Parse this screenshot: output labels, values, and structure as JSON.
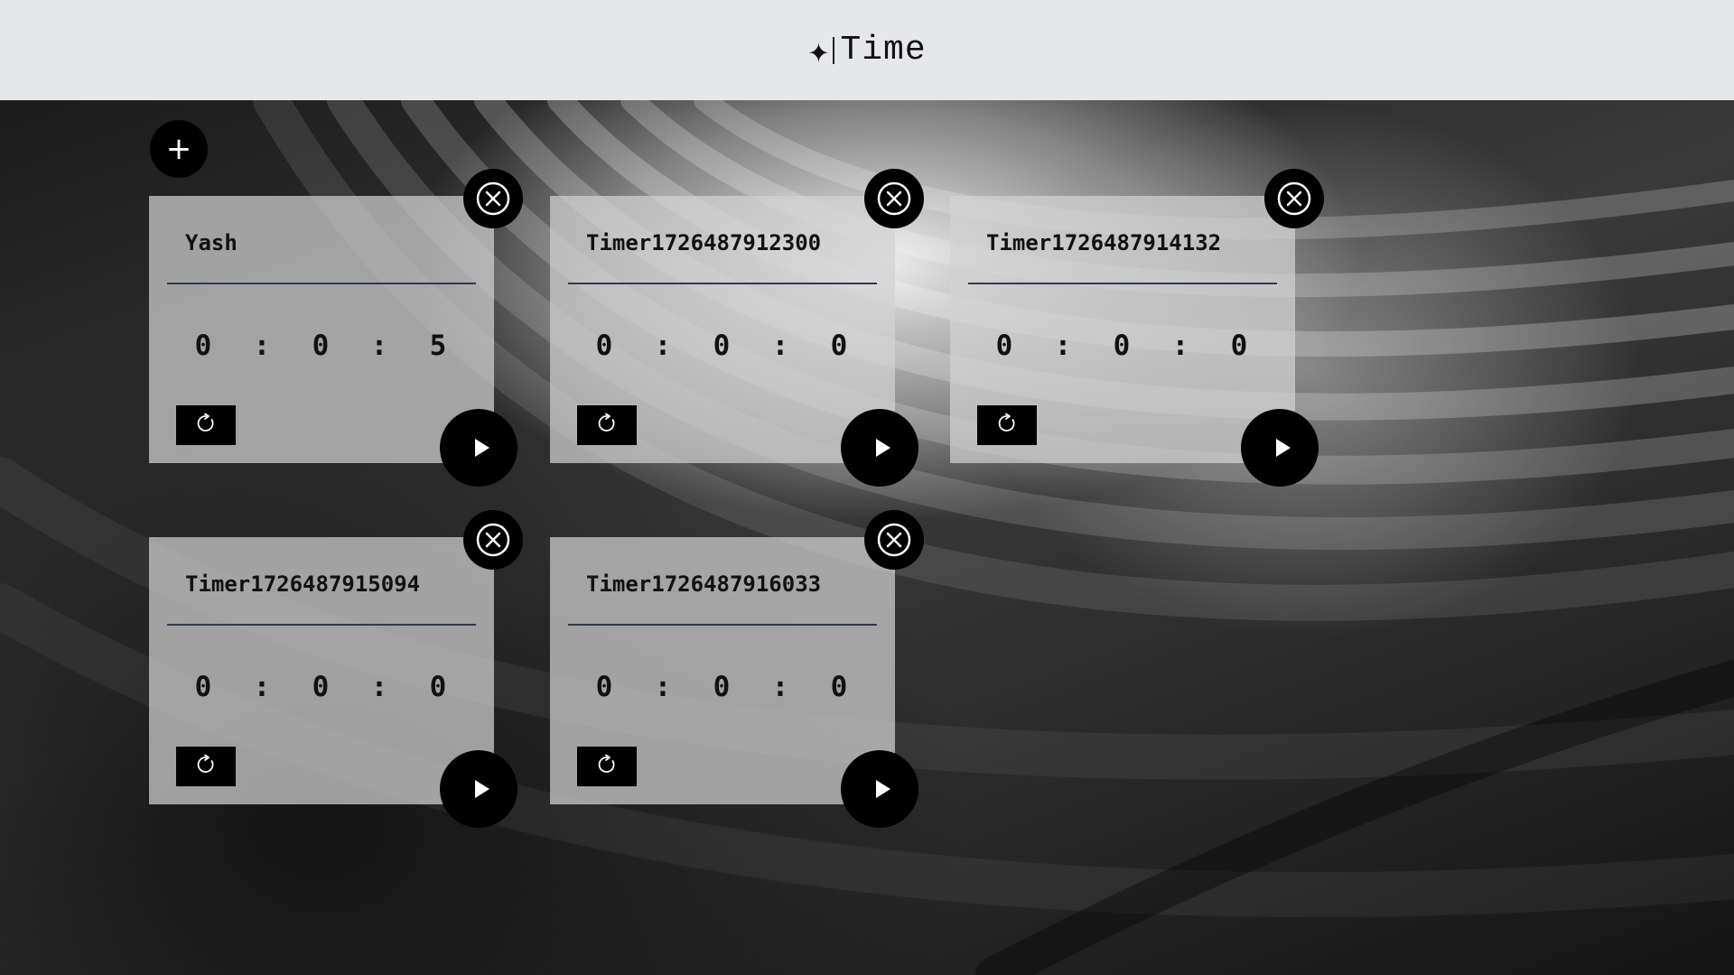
{
  "app": {
    "brand_glyph": "✦",
    "title": "Time"
  },
  "toolbar": {
    "add_label": "+"
  },
  "timers": [
    {
      "name": "Yash",
      "hours": "0",
      "minutes": "0",
      "seconds": "5"
    },
    {
      "name": "Timer1726487912300",
      "hours": "0",
      "minutes": "0",
      "seconds": "0"
    },
    {
      "name": "Timer1726487914132",
      "hours": "0",
      "minutes": "0",
      "seconds": "0"
    },
    {
      "name": "Timer1726487915094",
      "hours": "0",
      "minutes": "0",
      "seconds": "0"
    },
    {
      "name": "Timer1726487916033",
      "hours": "0",
      "minutes": "0",
      "seconds": "0"
    }
  ],
  "separator": ":",
  "icons": {
    "add": "plus-icon",
    "close": "close-circle-icon",
    "reset": "reset-icon",
    "play": "play-icon"
  },
  "colors": {
    "header_bg": "#e6e7ea",
    "button_bg": "#000000",
    "card_bg": "#d2d2d2"
  }
}
